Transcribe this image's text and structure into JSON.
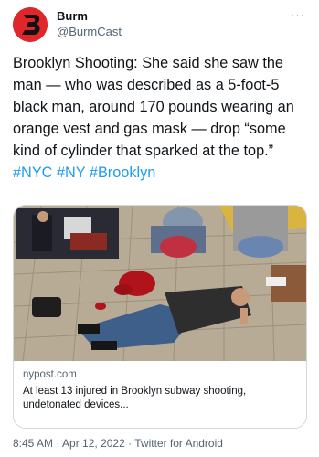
{
  "author": {
    "display_name": "Burm",
    "handle": "@BurmCast",
    "avatar_color": "#e0262b"
  },
  "menu": {
    "more_label": "···"
  },
  "tweet": {
    "text": "Brooklyn Shooting: She said she saw the man — who was described as a 5-foot-5 black man, around 170 pounds wearing an orange vest and gas mask — drop “some kind of cylinder that sparked at the top.”",
    "hashtags": [
      "#NYC",
      "#NY",
      "#Brooklyn"
    ],
    "hashtag_color": "#1d9bf0"
  },
  "card": {
    "domain": "nypost.com",
    "title": "At least 13 injured in Brooklyn subway shooting, undetonated devices..."
  },
  "footer": {
    "time": "8:45 AM",
    "separator": "·",
    "date": "Apr 12, 2022",
    "source": "Twitter for Android"
  }
}
